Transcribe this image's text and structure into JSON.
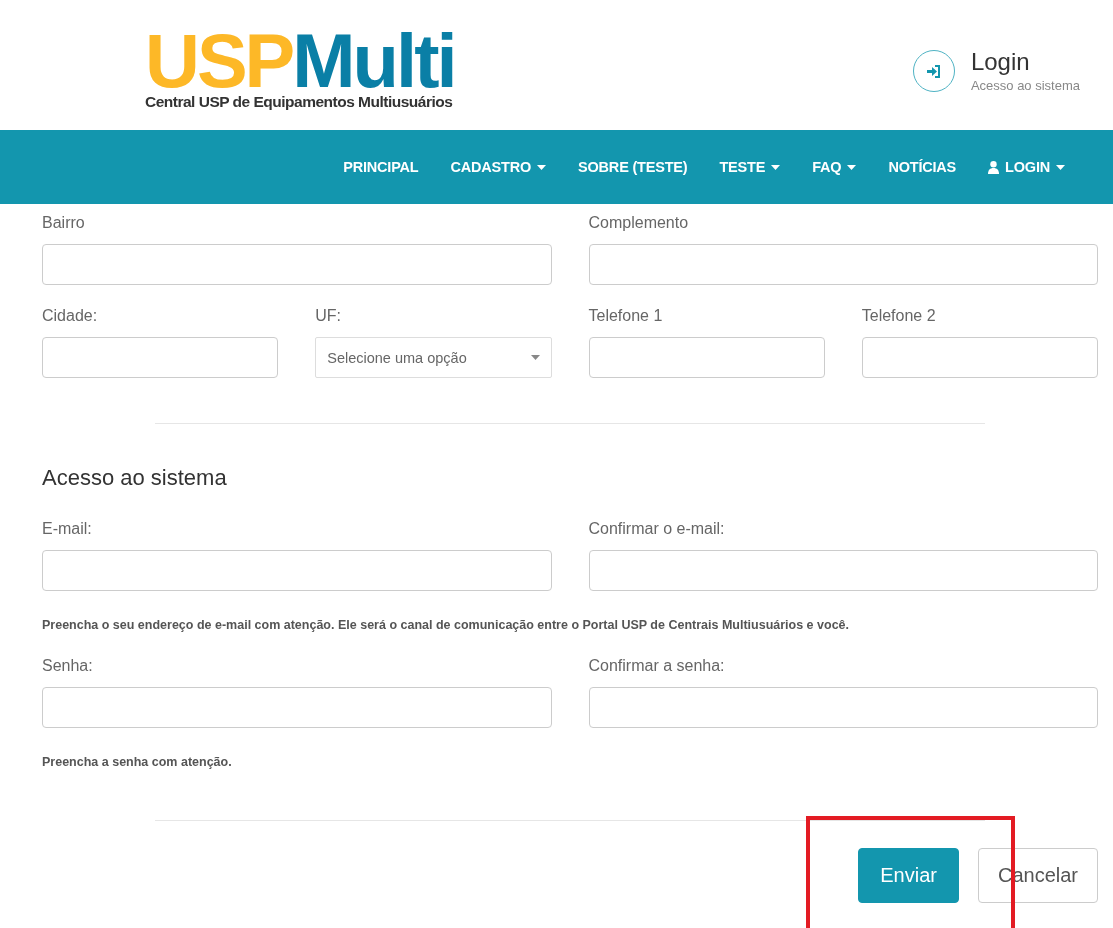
{
  "logo": {
    "brand_primary": "USP",
    "brand_secondary": "Multi",
    "tagline": "Central USP de Equipamentos Multiusuários"
  },
  "login_box": {
    "title": "Login",
    "subtitle": "Acesso ao sistema"
  },
  "nav": [
    {
      "label": "PRINCIPAL",
      "dropdown": false,
      "kind": "link"
    },
    {
      "label": "CADASTRO",
      "dropdown": true,
      "kind": "link"
    },
    {
      "label": "SOBRE (TESTE)",
      "dropdown": false,
      "kind": "link"
    },
    {
      "label": "TESTE",
      "dropdown": true,
      "kind": "link"
    },
    {
      "label": "FAQ",
      "dropdown": true,
      "kind": "link"
    },
    {
      "label": "NOTÍCIAS",
      "dropdown": false,
      "kind": "link"
    },
    {
      "label": "LOGIN",
      "dropdown": true,
      "kind": "account"
    }
  ],
  "address_rows": [
    {
      "fields": [
        {
          "label": "Bairro",
          "kind": "text"
        },
        {
          "label": "Complemento",
          "kind": "text"
        }
      ]
    },
    {
      "fields": [
        {
          "label": "Cidade:",
          "kind": "text"
        },
        {
          "label": "UF:",
          "kind": "select",
          "placeholder": "Selecione uma opção"
        },
        {
          "label": "Telefone 1",
          "kind": "text"
        },
        {
          "label": "Telefone 2",
          "kind": "text"
        }
      ]
    }
  ],
  "access_title": "Acesso ao sistema",
  "access_groups": [
    {
      "fields": [
        {
          "label": "E-mail:",
          "kind": "text"
        },
        {
          "label": "Confirmar o e-mail:",
          "kind": "text"
        }
      ],
      "hint": "Preencha o seu endereço de e-mail com atenção. Ele será o canal de comunicação entre o Portal USP de Centrais Multiusuários e você."
    },
    {
      "fields": [
        {
          "label": "Senha:",
          "kind": "text"
        },
        {
          "label": "Confirmar a senha:",
          "kind": "text"
        }
      ],
      "hint": "Preencha a senha com atenção."
    }
  ],
  "buttons": [
    {
      "label": "Enviar",
      "kind": "primary",
      "highlighted": true
    },
    {
      "label": "Cancelar",
      "kind": "secondary",
      "highlighted": false
    }
  ]
}
